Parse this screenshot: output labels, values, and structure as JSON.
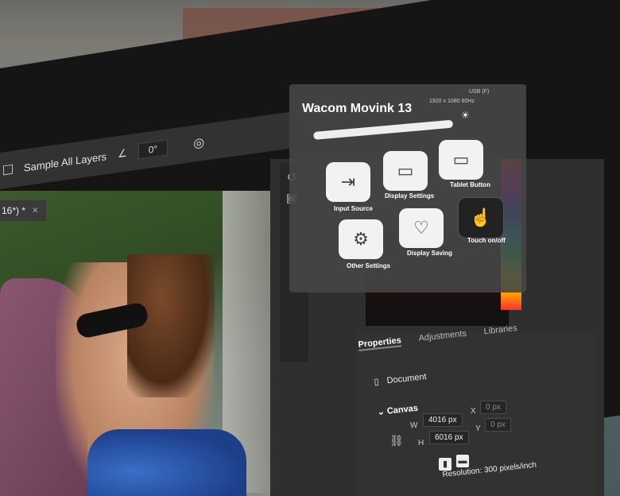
{
  "app": {
    "toolbar": {
      "sample_all_layers_label": "Sample All Layers",
      "angle_value": "0°"
    },
    "document_tab": {
      "label": "16*) *",
      "close_glyph": "✕"
    }
  },
  "osd": {
    "title": "Wacom Movink 13",
    "input_indicator": "USB (F)",
    "resolution_readout": "1920 x 1080 60Hz",
    "brightness_icon": "sun-icon",
    "buttons": [
      {
        "label": "Input Source",
        "icon": "input-source-icon"
      },
      {
        "label": "Display Settings",
        "icon": "display-settings-icon"
      },
      {
        "label": "Tablet Button",
        "icon": "tablet-button-icon"
      },
      {
        "label": "Other Settings",
        "icon": "gear-icon"
      },
      {
        "label": "Display Saving",
        "icon": "heart-display-icon"
      },
      {
        "label": "Touch on/off",
        "icon": "hand-pointer-icon"
      }
    ]
  },
  "panels": {
    "properties_tabs": [
      "Properties",
      "Adjustments",
      "Libraries"
    ],
    "document_label": "Document",
    "canvas_label": "Canvas",
    "width_label": "W",
    "width_value": "4016 px",
    "height_label": "H",
    "height_value": "6016 px",
    "x_label": "X",
    "x_value": "0 px",
    "y_label": "Y",
    "y_value": "0 px",
    "resolution": "Resolution: 300 pixels/inch"
  },
  "colors": {
    "accent": "#f2f2f2",
    "panel_bg": "#2f2f2f",
    "osd_bg": "#464646"
  }
}
